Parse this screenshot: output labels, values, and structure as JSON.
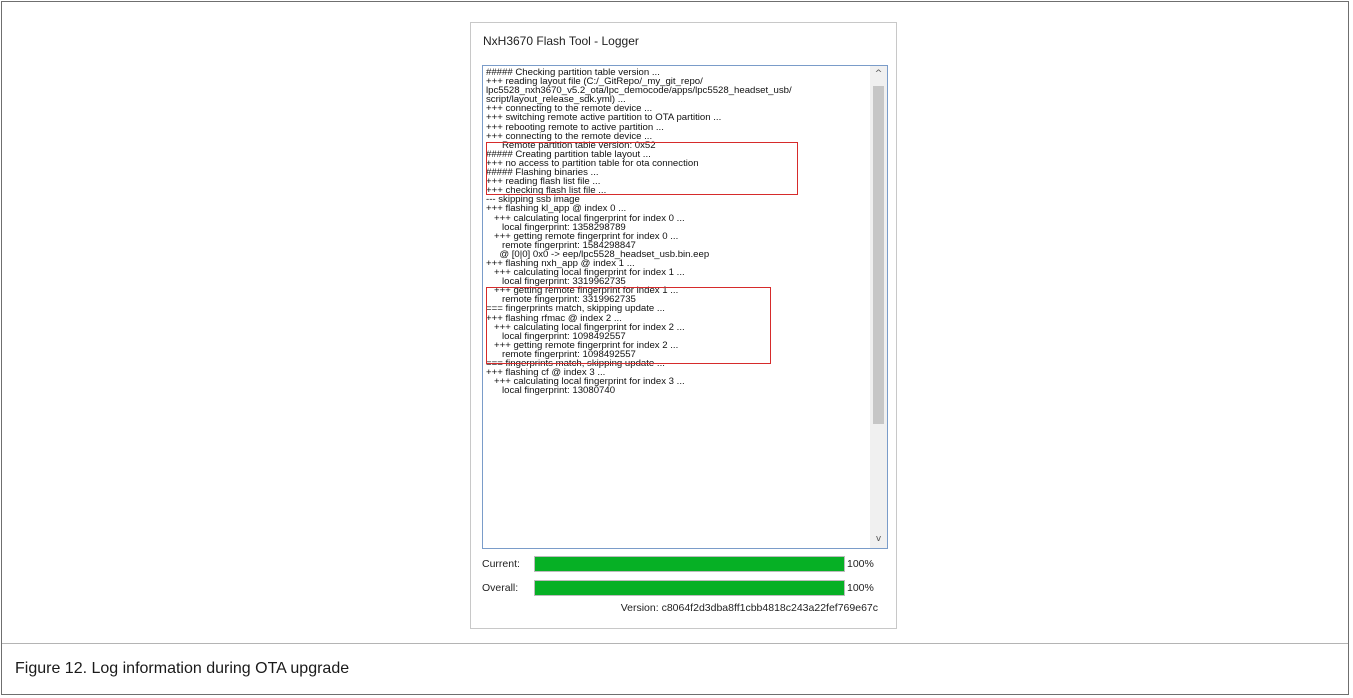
{
  "window": {
    "title": "NxH3670 Flash Tool - Logger"
  },
  "log": {
    "lines": [
      "##### Checking partition table version ...",
      "+++ reading layout file (C:/_GitRepo/_my_git_repo/",
      "lpc5528_nxh3670_v5.2_ota/lpc_democode/apps/lpc5528_headset_usb/",
      "script/layout_release_sdk.yml) ...",
      "+++ connecting to the remote device ...",
      "+++ switching remote active partition to OTA partition ...",
      "+++ rebooting remote to active partition ...",
      "+++ connecting to the remote device ...",
      "      Remote partition table version: 0x52",
      "##### Creating partition table layout ...",
      "+++ no access to partition table for ota connection",
      "##### Flashing binaries ...",
      "+++ reading flash list file ...",
      "+++ checking flash list file ...",
      "--- skipping ssb image",
      "+++ flashing kl_app @ index 0 ...",
      "   +++ calculating local fingerprint for index 0 ...",
      "      local fingerprint: 1358298789",
      "   +++ getting remote fingerprint for index 0 ...",
      "      remote fingerprint: 1584298847",
      "     @ [0|0] 0x0 -> eep/lpc5528_headset_usb.bin.eep",
      "+++ flashing nxh_app @ index 1 ...",
      "   +++ calculating local fingerprint for index 1 ...",
      "      local fingerprint: 3319962735",
      "   +++ getting remote fingerprint for index 1 ...",
      "      remote fingerprint: 3319962735",
      "=== fingerprints match, skipping update ...",
      "+++ flashing rfmac @ index 2 ...",
      "   +++ calculating local fingerprint for index 2 ...",
      "      local fingerprint: 1098492557",
      "   +++ getting remote fingerprint for index 2 ...",
      "      remote fingerprint: 1098492557",
      "=== fingerprints match, skipping update ...",
      "+++ flashing cf @ index 3 ...",
      "   +++ calculating local fingerprint for index 3 ...",
      "      local fingerprint: 13080740"
    ],
    "scroll_up_glyph": "^",
    "scroll_down_glyph": "v"
  },
  "progress": {
    "current_label": "Current:",
    "current_value": 100,
    "current_text": "100%",
    "overall_label": "Overall:",
    "overall_value": 100,
    "overall_text": "100%",
    "fill_color": "#06b025"
  },
  "version": "Version: c8064f2d3dba8ff1cbb4818c243a22fef769e67c",
  "caption": "Figure 12. Log information during OTA upgrade",
  "colors": {
    "highlight": "#d62b2b",
    "log_border": "#7a9cc9"
  }
}
